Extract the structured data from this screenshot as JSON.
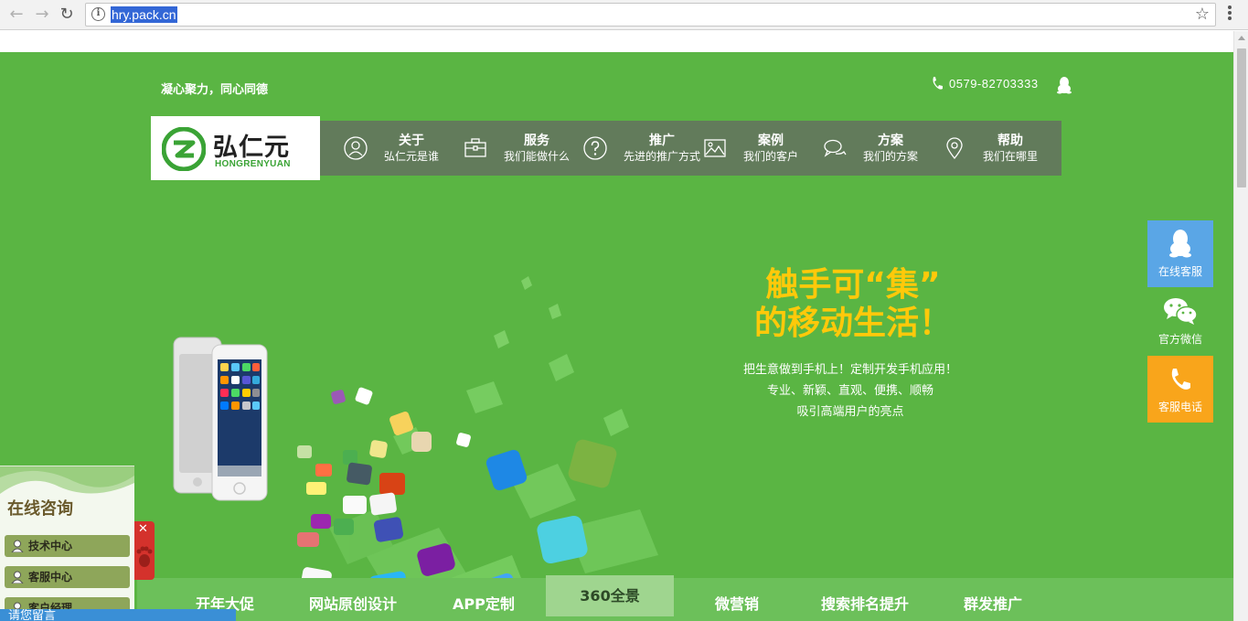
{
  "browser": {
    "url": "hry.pack.cn",
    "icons": [
      "back-arrow-icon",
      "forward-arrow-icon",
      "reload-icon",
      "info-icon",
      "star-icon",
      "menu-dots-icon"
    ]
  },
  "header": {
    "slogan": "凝心聚力，同心同德",
    "phone": "0579-82703333"
  },
  "logo": {
    "name_cn": "弘仁元",
    "name_en": "HONGRENYUAN"
  },
  "nav": [
    {
      "title": "关于",
      "subtitle": "弘仁元是谁",
      "icon": "user-icon"
    },
    {
      "title": "服务",
      "subtitle": "我们能做什么",
      "icon": "briefcase-icon"
    },
    {
      "title": "推广",
      "subtitle": "先进的推广方式",
      "icon": "question-icon"
    },
    {
      "title": "案例",
      "subtitle": "我们的客户",
      "icon": "image-icon"
    },
    {
      "title": "方案",
      "subtitle": "我们的方案",
      "icon": "chat-icon"
    },
    {
      "title": "帮助",
      "subtitle": "我们在哪里",
      "icon": "location-icon"
    }
  ],
  "banner": {
    "headline_line1": "触手可“集”",
    "headline_line2": "的移动生活！",
    "sub_line1": "把生意做到手机上！定制开发手机应用！",
    "sub_line2": "专业、新颖、直观、便携、顺畅",
    "sub_line3": "吸引高端用户的亮点"
  },
  "tabs": [
    {
      "label": "开年大促",
      "active": false
    },
    {
      "label": "网站原创设计",
      "active": false
    },
    {
      "label": "APP定制",
      "active": false
    },
    {
      "label": "360全景",
      "active": true
    },
    {
      "label": "微营销",
      "active": false
    },
    {
      "label": "搜索排名提升",
      "active": false
    },
    {
      "label": "群发推广",
      "active": false
    }
  ],
  "sidebar": {
    "qq_label": "在线客服",
    "wechat_label": "官方微信",
    "tel_label": "客服电话"
  },
  "consult": {
    "title": "在线咨询",
    "items": [
      "技术中心",
      "客服中心",
      "客户经理"
    ],
    "leave_message": "请您留言"
  },
  "colors": {
    "hero_green": "#5ab543",
    "nav_bg": "#627b5b",
    "headline_yellow": "#ffc90a",
    "qq_blue": "#5aa6e6",
    "tel_orange": "#f9a51b"
  }
}
